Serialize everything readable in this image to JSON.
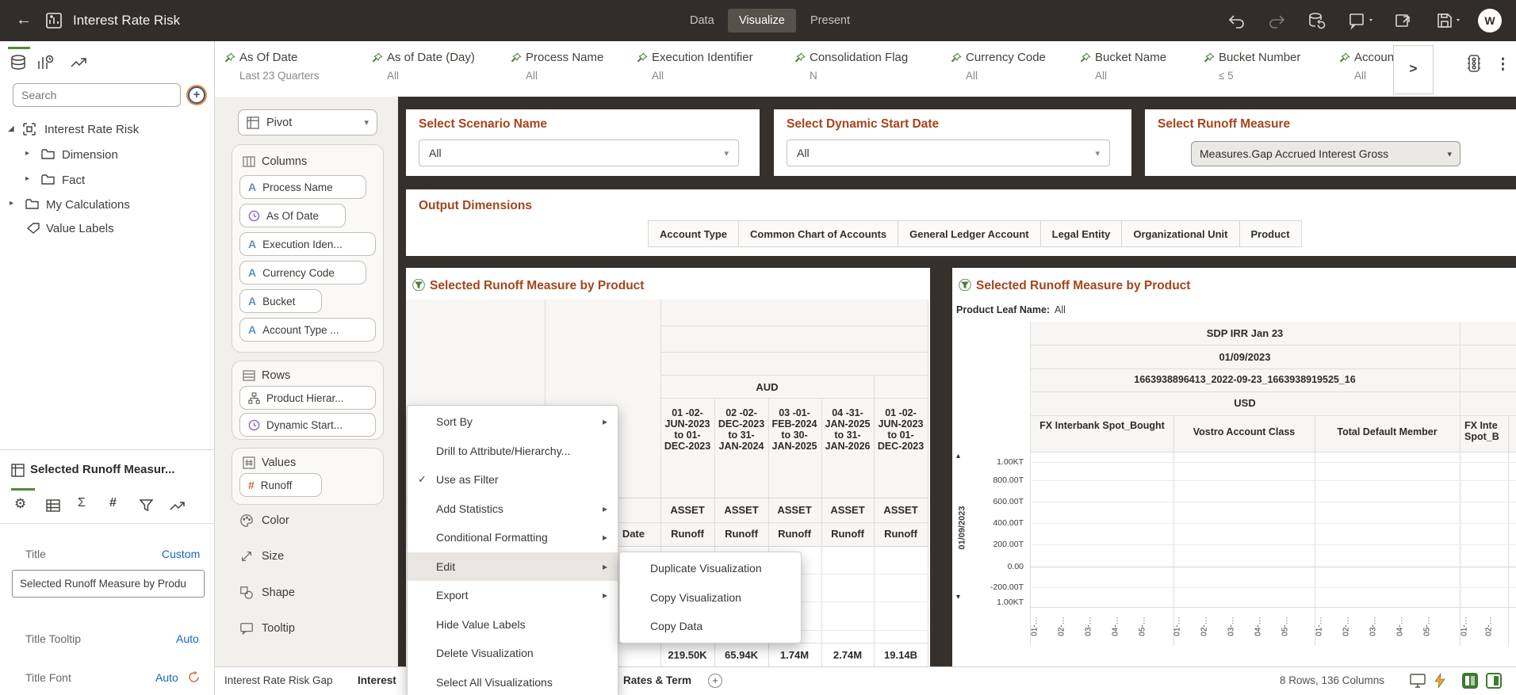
{
  "icons": {
    "back": "←",
    "chevron_down": "▾",
    "submenu_arrow": "▸",
    "check": "✓",
    "kebab": "⋮",
    "expand_filters": ">",
    "plus": "+",
    "tree_open": "◢",
    "tree_closed": "▸",
    "scroll_up": "▴",
    "scroll_down": "▾",
    "avatar": "W",
    "sigma": "Σ",
    "hash": "#",
    "gear": "⚙"
  },
  "topbar": {
    "title": "Interest Rate Risk",
    "tabs": [
      {
        "label": "Data"
      },
      {
        "label": "Visualize"
      },
      {
        "label": "Present"
      }
    ]
  },
  "filterbar": {
    "filters": [
      {
        "name": "As Of Date",
        "value": "Last 23 Quarters"
      },
      {
        "name": "As of Date (Day)",
        "value": "All"
      },
      {
        "name": "Process Name",
        "value": "All"
      },
      {
        "name": "Execution Identifier",
        "value": "All"
      },
      {
        "name": "Consolidation Flag",
        "value": "N"
      },
      {
        "name": "Currency Code",
        "value": "All"
      },
      {
        "name": "Bucket Name",
        "value": "All"
      },
      {
        "name": "Bucket Number",
        "value": "≤ 5"
      },
      {
        "name": "Account",
        "value": "All"
      }
    ]
  },
  "data_panel": {
    "search_placeholder": "Search",
    "tree": [
      {
        "label": "Interest Rate Risk"
      },
      {
        "label": "Dimension"
      },
      {
        "label": "Fact"
      },
      {
        "label": "My Calculations"
      },
      {
        "label": "Value Labels"
      }
    ]
  },
  "grammar": {
    "viz_type": "Pivot",
    "columns_label": "Columns",
    "column_pills": [
      "Process Name",
      "As Of Date",
      "Execution Iden...",
      "Currency Code",
      "Bucket",
      "Account Type ..."
    ],
    "rows_label": "Rows",
    "row_pills": [
      "Product Hierar...",
      "Dynamic Start..."
    ],
    "values_label": "Values",
    "value_pills": [
      "Runoff"
    ],
    "extras": [
      "Color",
      "Size",
      "Shape",
      "Tooltip"
    ]
  },
  "properties": {
    "header": "Selected Runoff Measur...",
    "title_label": "Title",
    "title_mode": "Custom",
    "title_value": "Selected Runoff Measure by Produ",
    "tooltip_label": "Title Tooltip",
    "tooltip_mode": "Auto",
    "font_label": "Title Font",
    "font_mode": "Auto"
  },
  "prompts": [
    {
      "title": "Select Scenario Name",
      "value": "All"
    },
    {
      "title": "Select Dynamic Start Date",
      "value": "All"
    },
    {
      "title": "Select Runoff Measure",
      "value": "Measures.Gap Accrued Interest Gross"
    }
  ],
  "output_dimensions": {
    "title": "Output Dimensions",
    "buttons": [
      "Account Type",
      "Common Chart of Accounts",
      "General Ledger Account",
      "Legal Entity",
      "Organizational Unit",
      "Product"
    ]
  },
  "left_viz": {
    "title": "Selected Runoff Measure by Product",
    "currency": "AUD",
    "buckets": [
      "01 -02- JUN-2023 to 01- DEC-2023",
      "02 -02- DEC-2023 to 31- JAN-2024",
      "03 -01- FEB-2024 to 30- JAN-2025",
      "04 -31- JAN-2025 to 31- JAN-2026",
      "01 -02- JUN-2023 to 01- DEC-2023"
    ],
    "asset_label": "ASSET",
    "measure_label": "Runoff",
    "row_header": "Date",
    "totals": [
      "219.50K",
      "65.94K",
      "1.74M",
      "2.74M",
      "19.14B"
    ]
  },
  "context_menu": {
    "items": [
      {
        "label": "Sort By"
      },
      {
        "label": "Drill to Attribute/Hierarchy..."
      },
      {
        "label": "Use as Filter"
      },
      {
        "label": "Add Statistics"
      },
      {
        "label": "Conditional Formatting"
      },
      {
        "label": "Edit"
      },
      {
        "label": "Export"
      },
      {
        "label": "Hide Value Labels"
      },
      {
        "label": "Delete Visualization"
      },
      {
        "label": "Select All Visualizations"
      }
    ],
    "submenu": [
      "Duplicate Visualization",
      "Copy Visualization",
      "Copy Data"
    ]
  },
  "right_viz": {
    "title": "Selected Runoff Measure by Product",
    "leaf_label": "Product Leaf Name:",
    "leaf_value": "All",
    "bands": [
      "SDP IRR Jan 23",
      "01/09/2023",
      "1663938896413_2022-09-23_1663938919525_16",
      "USD"
    ],
    "columns": [
      "FX Interbank Spot_Bought",
      "Vostro Account Class",
      "Total Default Member",
      "FX Inte\nSpot_B"
    ],
    "row_label": "01/09/2023",
    "axis_labels": [
      "1.00KT",
      "800.00T",
      "600.00T",
      "400.00T",
      "200.00T",
      "0.00",
      "-200.00T",
      "1.00KT"
    ],
    "x_labels": [
      "01-…",
      "02-…",
      "03-…",
      "04-…",
      "05-…"
    ]
  },
  "statusbar": {
    "tabs": [
      "Interest Rate Risk Gap",
      "Interest",
      "Rates & Term"
    ],
    "status": "8 Rows, 136 Columns"
  }
}
